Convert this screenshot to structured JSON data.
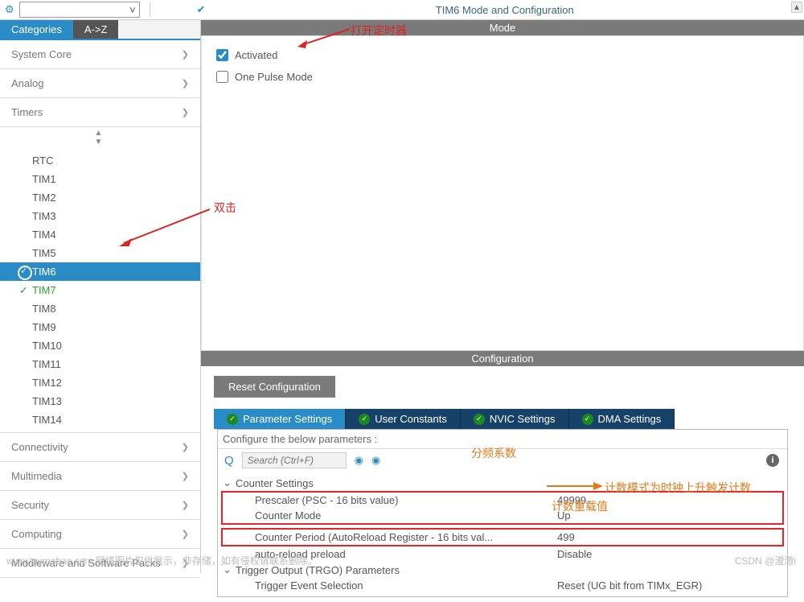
{
  "header": {
    "title": "TIM6 Mode and Configuration"
  },
  "left_tabs": {
    "categories": "Categories",
    "az": "A->Z"
  },
  "sidebar": {
    "groups": [
      {
        "label": "System Core",
        "open": false
      },
      {
        "label": "Analog",
        "open": false
      },
      {
        "label": "Timers",
        "open": true
      }
    ],
    "timers": [
      "RTC",
      "TIM1",
      "TIM2",
      "TIM3",
      "TIM4",
      "TIM5",
      "TIM6",
      "TIM7",
      "TIM8",
      "TIM9",
      "TIM10",
      "TIM11",
      "TIM12",
      "TIM13",
      "TIM14"
    ],
    "selected": "TIM6",
    "configured": "TIM7",
    "bottom_groups": [
      "Connectivity",
      "Multimedia",
      "Security",
      "Computing",
      "Middleware and Software Packs"
    ]
  },
  "mode": {
    "bar": "Mode",
    "activated": "Activated",
    "one_pulse": "One Pulse Mode"
  },
  "config": {
    "bar": "Configuration",
    "reset": "Reset Configuration",
    "tabs": [
      "Parameter Settings",
      "User Constants",
      "NVIC Settings",
      "DMA Settings"
    ],
    "configure_hint": "Configure the below parameters :",
    "search_placeholder": "Search (Ctrl+F)",
    "tree": {
      "counter_settings": "Counter Settings",
      "prescaler_lbl": "Prescaler (PSC - 16 bits value)",
      "prescaler_val": "49999",
      "counter_mode_lbl": "Counter Mode",
      "counter_mode_val": "Up",
      "counter_period_lbl": "Counter Period (AutoReload Register - 16 bits val...",
      "counter_period_val": "499",
      "autoreload_lbl": "auto-reload preload",
      "autoreload_val": "Disable",
      "trgo": "Trigger Output (TRGO) Parameters",
      "trigger_evt_lbl": "Trigger Event Selection",
      "trigger_evt_val": "Reset (UG bit from TIMx_EGR)"
    }
  },
  "annotations": {
    "open_timer": "打开定时器",
    "double_click": "双击",
    "prescaler_note": "分频系数",
    "counter_note": "计数模式为时钟上升触发计数",
    "reload_note": "计数重载值"
  },
  "footer": {
    "left": "www.toymoban.com  网络图片仅供展示，非存储，如有侵权请联系删除。",
    "right": "CSDN @澄澈i"
  }
}
